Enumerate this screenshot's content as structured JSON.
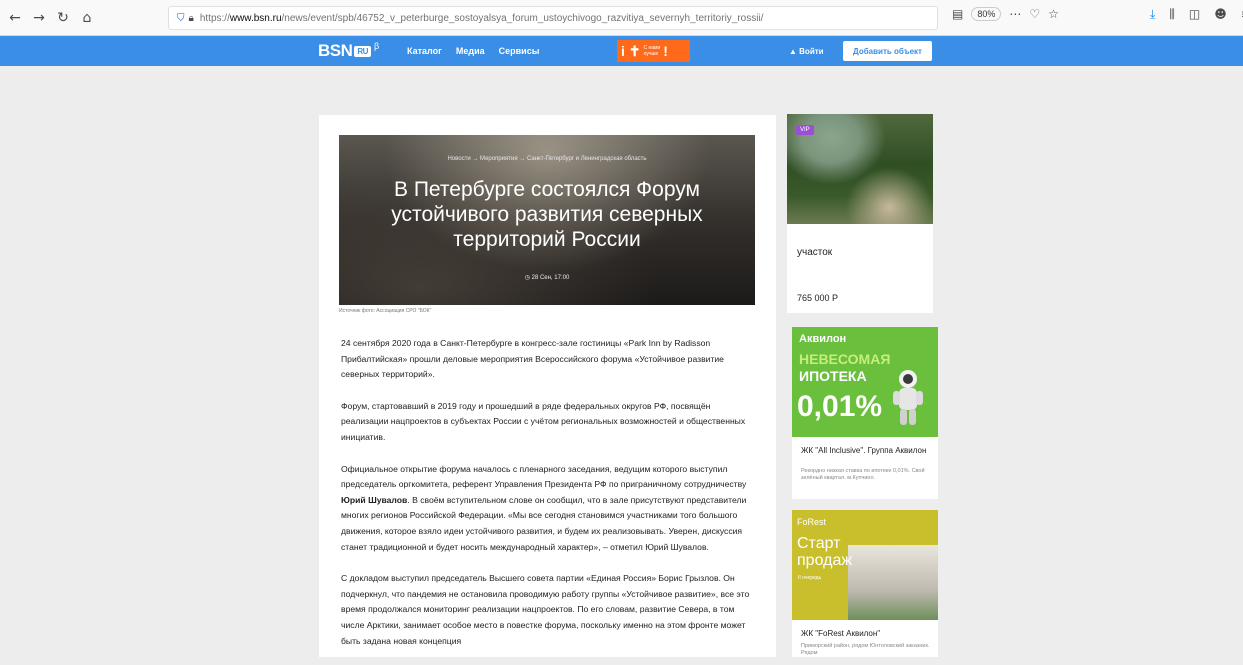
{
  "browser": {
    "url_host": "www.bsn.ru",
    "url_prefix": "https://",
    "url_path": "/news/event/spb/46752_v_peterburge_sostoyalsya_forum_ustoychivogo_razvitiya_severnyh_territoriy_rossii/",
    "zoom": "80%",
    "icons": [
      "back-icon",
      "forward-icon",
      "reload-icon",
      "home-icon",
      "shield-icon",
      "lock-icon",
      "reader-icon",
      "more-icon",
      "pocket-icon",
      "bookmark-star-icon",
      "download-icon",
      "library-icon",
      "sidebar-icon",
      "account-icon",
      "menu-icon"
    ]
  },
  "header": {
    "logo": "BSN",
    "logo_ru": "RU",
    "logo_beta": "β",
    "menu": [
      "Каталог",
      "Медиа",
      "Сервисы"
    ],
    "promo_big": "i ✝",
    "promo_small1": "С нами",
    "promo_small2": "лучше",
    "promo_bang": "!",
    "login": "Войти",
    "add_button": "Добавить объект",
    "colors": {
      "header_bg": "#3a8ee6",
      "promo_bg": "#ff6a1a"
    }
  },
  "article": {
    "breadcrumbs": "Новости → Мероприятия → Санкт-Петербург и Ленинградская область",
    "title": "В Петербурге состоялся Форум устойчивого развития северных территорий России",
    "date": "◷ 28 Сен, 17:00",
    "source": "Источник фото: Ассоциация СРО \"БОК\"",
    "p1": "24 сентября 2020 года в Санкт-Петербурге в конгресс-зале гостиницы «Park Inn by Radisson Прибалтийская» прошли деловые мероприятия Всероссийского форума «Устойчивое развитие северных территорий».",
    "p2": "Форум, стартовавший в 2019 году и прошедший в ряде федеральных округов РФ, посвящён реализации нацпроектов в субъектах России с учётом региональных возможностей и общественных инициатив.",
    "p3_a": "Официальное открытие форума началось с пленарного заседания, ведущим которого выступил председатель оргкомитета, референт Управления Президента РФ по приграничному сотрудничеству ",
    "p3_bold": "Юрий Шувалов",
    "p3_b": ". В своём вступительном слове он сообщил, что в зале присутствуют представители многих регионов Российской Федерации. «Мы все сегодня становимся участниками того большого движения, которое взяло идеи устойчивого развития, и будем их реализовывать. Уверен, дискуссия станет традиционной и будет носить международный характер», – отметил Юрий Шувалов.",
    "p4": "С докладом выступил председатель Высшего совета партии «Единая Россия» Борис Грызлов. Он подчеркнул, что пандемия не остановила проводимую работу группы «Устойчивое развитие», все это время продолжался мониторинг реализации нацпроектов. По его словам, развитие Севера, в том числе Арктики, занимает особое место в повестке форума, поскольку именно на этом фронте может быть задана новая концепция"
  },
  "sidebar": {
    "card1": {
      "badge": "VIP",
      "title": "участок",
      "price": "765 000 Р"
    },
    "card2": {
      "brand": "Аквилон",
      "headline1": "НЕВЕСОМАЯ",
      "headline2": "ИПОТЕКА",
      "rate": "0,01%",
      "title": "ЖК \"All Inclusive\". Группа Аквилон",
      "desc": "Рекордно низкая ставка по ипотеке 0,01%. Свой зелёный квартал. м.Купчино."
    },
    "card3": {
      "brand": "FoRest",
      "headline1": "Старт",
      "headline2": "продаж",
      "queue": "II очередь",
      "title": "ЖК \"FoRest Аквилон\"",
      "desc": "Приморский район, рядом Юнтоловский заказник. Рядом"
    }
  }
}
